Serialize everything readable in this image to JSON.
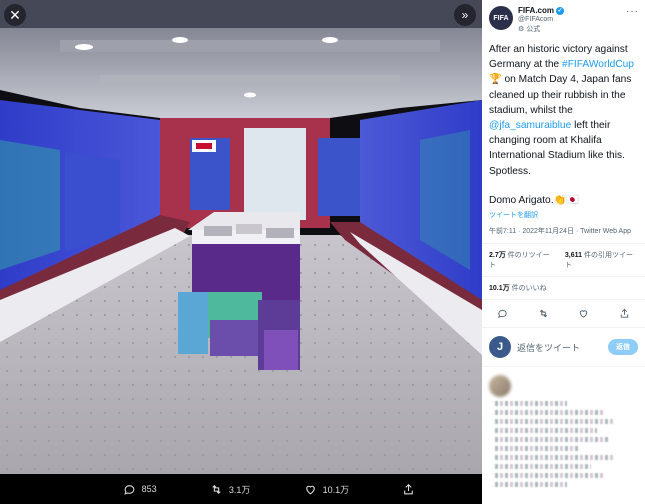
{
  "viewer": {
    "close_icon": "close-icon",
    "expand_icon": "expand-icon",
    "bar": {
      "replies": "853",
      "retweets": "3.1万",
      "likes": "10.1万"
    }
  },
  "tweet": {
    "avatar_text": "FIFA",
    "display_name": "FIFA.com",
    "handle": "@FIFAcom",
    "official_label": "公式",
    "text_1": "After an historic victory against Germany at the ",
    "hashtag": "#FIFAWorldCup",
    "text_2": " 🏆 on Match Day 4, Japan fans cleaned up their rubbish in the stadium, whilst the ",
    "mention": "@jfa_samuraiblue",
    "text_3": " left their changing room at Khalifa International Stadium like this. Spotless.",
    "text_4": "Domo Arigato.👏🇯🇵",
    "translate": "ツイートを翻訳",
    "timestamp": "午前7:11 · 2022年11月24日 · Twitter Web App",
    "retweet_count": "2.7万",
    "retweet_label": " 件のリツイート",
    "quote_count": "3,611",
    "quote_label": " 件の引用ツイート",
    "like_count": "10.1万",
    "like_label": " 件のいいね"
  },
  "reply": {
    "avatar_letter": "J",
    "placeholder": "返信をツイート",
    "button": "返信"
  }
}
